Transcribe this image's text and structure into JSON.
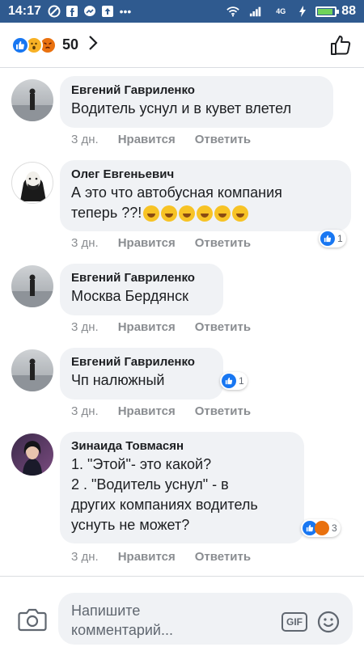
{
  "status_bar": {
    "time": "14:17",
    "signal_label": "4G",
    "battery": "88",
    "battery_level": 0.88
  },
  "header": {
    "reaction_count": "50",
    "reactions": [
      "like-icon",
      "wow-icon",
      "angry-icon"
    ]
  },
  "comments": [
    {
      "name": "Евгений Гавриленко",
      "lines": [
        "Водитель уснул и в кувет влетел"
      ],
      "time": "3 дн.",
      "like": "Нравится",
      "reply": "Ответить",
      "reactions": null
    },
    {
      "name": "Олег Евгеньевич",
      "lines": [
        "А это что автобусная компания",
        "теперь ??!"
      ],
      "time": "3 дн.",
      "like": "Нравится",
      "reply": "Ответить",
      "reactions": "1"
    },
    {
      "name": "Евгений Гавриленко",
      "lines": [
        "Москва Бердянск"
      ],
      "time": "3 дн.",
      "like": "Нравится",
      "reply": "Ответить",
      "reactions": null
    },
    {
      "name": "Евгений Гавриленко",
      "lines": [
        "Чп налюжный"
      ],
      "time": "3 дн.",
      "like": "Нравится",
      "reply": "Ответить",
      "reactions": "1"
    },
    {
      "name": "Зинаида Товмасян",
      "lines": [
        "1. \"Этой\"- это какой?",
        "2 . \"Водитель уснул\" - в",
        "других компаниях водитель",
        "уснуть не может?"
      ],
      "time": "3 дн.",
      "like": "Нравится",
      "reply": "Ответить",
      "reactions": "3"
    }
  ],
  "composer": {
    "placeholder_line1": "Напишите",
    "placeholder_line2": "комментарий...",
    "gif_label": "GIF"
  }
}
